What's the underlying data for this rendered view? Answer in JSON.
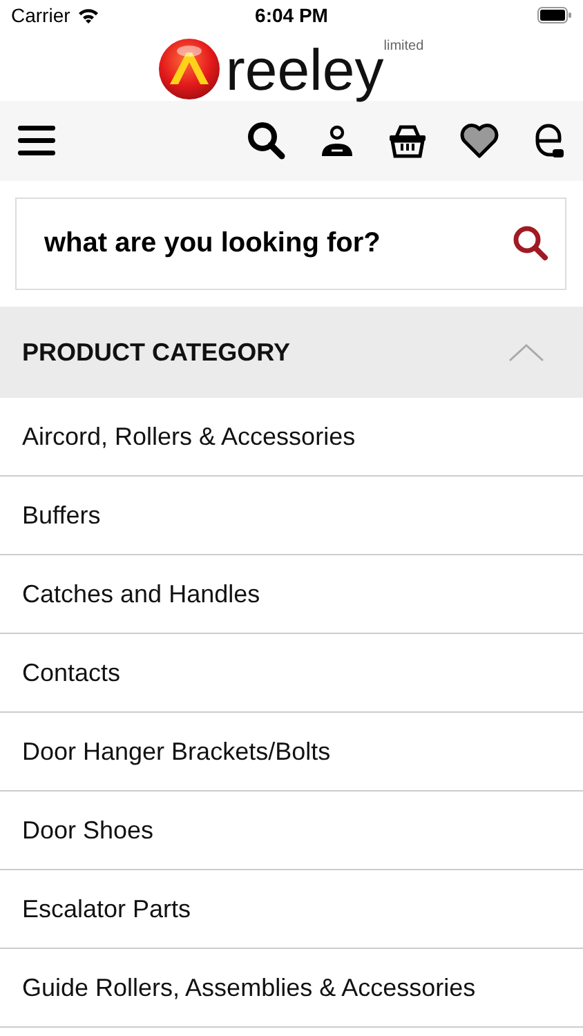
{
  "status_bar": {
    "carrier": "Carrier",
    "time": "6:04 PM"
  },
  "logo": {
    "name": "reeley",
    "suffix": "limited"
  },
  "search": {
    "placeholder": "what are you looking for?"
  },
  "category": {
    "title": "PRODUCT CATEGORY",
    "expanded": true,
    "items": [
      "Aircord, Rollers & Accessories",
      "Buffers",
      "Catches and Handles",
      "Contacts",
      "Door Hanger Brackets/Bolts",
      "Door Shoes",
      "Escalator Parts",
      "Guide Rollers, Assemblies & Accessories"
    ]
  }
}
